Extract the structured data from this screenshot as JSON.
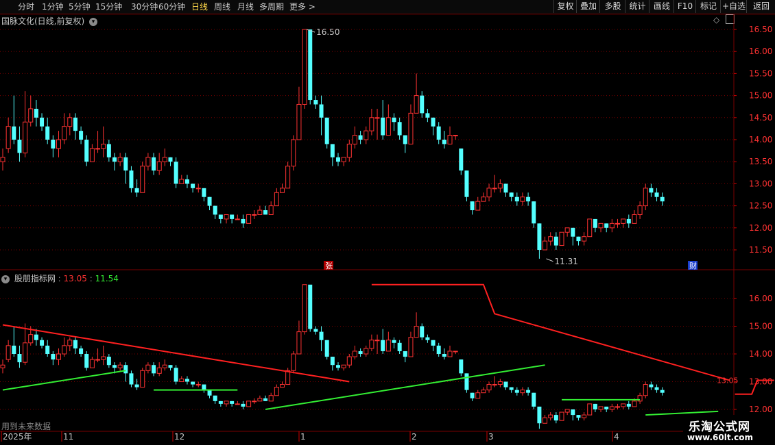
{
  "toolbar": {
    "periods": [
      "分时",
      "1分钟",
      "5分钟",
      "15分钟",
      "30分钟",
      "60分钟",
      "日线",
      "周线",
      "月线",
      "多周期",
      "更多 >"
    ],
    "active_period": "日线",
    "right_buttons": [
      "复权",
      "叠加",
      "多股",
      "统计",
      "画线",
      "F10",
      "标记",
      "+自选",
      "返回"
    ]
  },
  "main_chart": {
    "title": "国脉文化(日线,前复权)",
    "price_ticks": [
      "16.50",
      "16.00",
      "15.50",
      "15.00",
      "14.50",
      "14.00",
      "13.50",
      "13.00",
      "12.50",
      "12.00",
      "11.50"
    ],
    "high_label": "16.50",
    "low_label": "11.31",
    "badge_zhang": "张",
    "badge_cai": "财"
  },
  "indicator": {
    "name": "股朋指标网",
    "value_red": "13.05",
    "value_green": "11.54",
    "ticks": [
      "16.00",
      "15.00",
      "14.00",
      "13.00",
      "12.00"
    ],
    "current_label": "13.05",
    "footer_note": "用到未来数据"
  },
  "date_axis": [
    "2025年",
    "11",
    "12",
    "1",
    "2",
    "3",
    "4"
  ],
  "watermark": {
    "line1": "乐淘公式网",
    "line2": "www.60lt.com"
  },
  "colors": {
    "up": "#ff3232",
    "down": "#54ffff",
    "upper_line": "#ff2020",
    "lower_line": "#33ee33",
    "grid": "#7a0000"
  },
  "chart_data": {
    "type": "candlestick",
    "y_min": 11.31,
    "y_max": 16.5,
    "candles": [
      [
        13.5,
        13.6,
        13.3,
        13.8
      ],
      [
        13.8,
        14.3,
        13.7,
        14.5
      ],
      [
        14.3,
        14.0,
        13.9,
        15.0
      ],
      [
        14.0,
        13.7,
        13.5,
        14.3
      ],
      [
        13.7,
        14.4,
        13.6,
        15.1
      ],
      [
        14.4,
        14.7,
        14.3,
        15.0
      ],
      [
        14.7,
        14.5,
        14.3,
        14.9
      ],
      [
        14.5,
        14.3,
        14.2,
        14.6
      ],
      [
        14.3,
        14.0,
        13.9,
        14.5
      ],
      [
        14.0,
        13.8,
        13.6,
        14.1
      ],
      [
        13.8,
        14.0,
        13.6,
        14.2
      ],
      [
        14.0,
        14.3,
        13.9,
        14.6
      ],
      [
        14.3,
        14.5,
        14.1,
        14.6
      ],
      [
        14.5,
        14.2,
        14.0,
        14.6
      ],
      [
        14.2,
        14.0,
        13.9,
        14.3
      ],
      [
        14.0,
        13.5,
        13.4,
        14.1
      ],
      [
        13.5,
        13.8,
        13.5,
        13.9
      ],
      [
        13.8,
        13.8,
        13.7,
        14.2
      ],
      [
        13.8,
        13.9,
        13.6,
        14.3
      ],
      [
        13.9,
        13.6,
        13.5,
        14.0
      ],
      [
        13.6,
        13.5,
        13.3,
        13.7
      ],
      [
        13.5,
        13.6,
        13.4,
        13.7
      ],
      [
        13.6,
        13.3,
        13.0,
        13.7
      ],
      [
        13.3,
        12.9,
        12.8,
        13.4
      ],
      [
        12.9,
        12.8,
        12.7,
        13.1
      ],
      [
        12.8,
        13.4,
        12.8,
        13.5
      ],
      [
        13.4,
        13.6,
        13.3,
        13.7
      ],
      [
        13.6,
        13.3,
        13.2,
        13.7
      ],
      [
        13.3,
        13.5,
        13.2,
        13.7
      ],
      [
        13.5,
        13.6,
        13.4,
        13.8
      ],
      [
        13.6,
        13.5,
        13.4,
        13.6
      ],
      [
        13.5,
        13.0,
        12.9,
        13.6
      ],
      [
        13.0,
        13.1,
        13.0,
        13.2
      ],
      [
        13.1,
        13.0,
        12.9,
        13.2
      ],
      [
        13.0,
        12.9,
        12.8,
        13.0
      ],
      [
        12.9,
        12.9,
        12.8,
        13.0
      ],
      [
        12.9,
        12.7,
        12.6,
        12.9
      ],
      [
        12.7,
        12.5,
        12.4,
        12.7
      ],
      [
        12.5,
        12.3,
        12.2,
        12.5
      ],
      [
        12.3,
        12.2,
        12.1,
        12.3
      ],
      [
        12.2,
        12.3,
        12.1,
        12.3
      ],
      [
        12.3,
        12.2,
        12.1,
        12.3
      ],
      [
        12.2,
        12.2,
        12.2,
        12.3
      ],
      [
        12.2,
        12.1,
        12.0,
        12.3
      ],
      [
        12.1,
        12.3,
        12.1,
        12.3
      ],
      [
        12.3,
        12.3,
        12.2,
        12.4
      ],
      [
        12.3,
        12.4,
        12.3,
        12.5
      ],
      [
        12.4,
        12.3,
        12.3,
        12.5
      ],
      [
        12.3,
        12.5,
        12.3,
        12.6
      ],
      [
        12.5,
        12.8,
        12.5,
        12.9
      ],
      [
        12.8,
        12.9,
        12.8,
        13.0
      ],
      [
        12.9,
        13.4,
        12.9,
        13.5
      ],
      [
        13.4,
        14.0,
        13.3,
        14.1
      ],
      [
        14.0,
        14.8,
        14.0,
        15.2
      ],
      [
        14.8,
        16.5,
        14.7,
        16.5
      ],
      [
        16.5,
        14.9,
        14.8,
        16.0
      ],
      [
        14.9,
        14.8,
        14.7,
        15.0
      ],
      [
        14.8,
        14.5,
        14.1,
        15.0
      ],
      [
        14.5,
        13.9,
        13.8,
        14.5
      ],
      [
        13.9,
        13.6,
        13.4,
        13.9
      ],
      [
        13.6,
        13.5,
        13.4,
        13.7
      ],
      [
        13.5,
        13.6,
        13.4,
        13.6
      ],
      [
        13.6,
        13.9,
        13.5,
        14.0
      ],
      [
        13.9,
        14.1,
        13.8,
        14.3
      ],
      [
        14.1,
        14.0,
        13.9,
        14.2
      ],
      [
        14.0,
        14.2,
        13.9,
        14.3
      ],
      [
        14.2,
        14.5,
        14.1,
        14.7
      ],
      [
        14.5,
        14.5,
        14.0,
        14.7
      ],
      [
        14.5,
        14.1,
        14.0,
        14.9
      ],
      [
        14.1,
        14.5,
        14.1,
        14.8
      ],
      [
        14.5,
        14.4,
        14.2,
        14.6
      ],
      [
        14.4,
        14.1,
        14.0,
        14.5
      ],
      [
        14.1,
        13.9,
        13.7,
        14.1
      ],
      [
        13.9,
        14.6,
        13.9,
        14.8
      ],
      [
        14.6,
        15.0,
        14.6,
        15.5
      ],
      [
        15.0,
        14.6,
        14.5,
        15.1
      ],
      [
        14.6,
        14.5,
        14.4,
        14.7
      ],
      [
        14.5,
        14.3,
        14.1,
        14.5
      ],
      [
        14.3,
        14.0,
        13.9,
        14.4
      ],
      [
        14.0,
        13.9,
        13.8,
        14.2
      ],
      [
        13.9,
        14.1,
        13.9,
        14.3
      ],
      [
        14.1,
        14.1,
        14.0,
        14.1
      ],
      [
        13.8,
        13.3,
        13.2,
        13.8
      ],
      [
        13.3,
        12.7,
        12.6,
        13.3
      ],
      [
        12.6,
        12.4,
        12.3,
        12.6
      ],
      [
        12.4,
        12.6,
        12.4,
        12.7
      ],
      [
        12.6,
        12.7,
        12.6,
        12.8
      ],
      [
        12.7,
        12.9,
        12.6,
        13.0
      ],
      [
        12.9,
        12.9,
        12.8,
        13.2
      ],
      [
        12.9,
        13.0,
        12.8,
        13.1
      ],
      [
        13.0,
        12.8,
        12.7,
        13.0
      ],
      [
        12.8,
        12.7,
        12.6,
        12.8
      ],
      [
        12.7,
        12.6,
        12.5,
        12.8
      ],
      [
        12.6,
        12.7,
        12.5,
        12.8
      ],
      [
        12.7,
        12.6,
        12.5,
        12.8
      ],
      [
        12.6,
        12.1,
        12.0,
        12.6
      ],
      [
        12.1,
        11.5,
        11.3,
        12.1
      ],
      [
        11.5,
        11.7,
        11.5,
        11.8
      ],
      [
        11.7,
        11.8,
        11.6,
        11.9
      ],
      [
        11.8,
        11.6,
        11.5,
        11.9
      ],
      [
        11.6,
        11.9,
        11.6,
        11.9
      ],
      [
        11.9,
        12.0,
        11.8,
        12.0
      ],
      [
        12.0,
        11.8,
        11.6,
        12.0
      ],
      [
        11.8,
        11.7,
        11.6,
        11.8
      ],
      [
        11.7,
        11.8,
        11.6,
        11.9
      ],
      [
        11.8,
        12.2,
        11.8,
        12.2
      ],
      [
        12.2,
        12.0,
        11.9,
        12.2
      ],
      [
        12.0,
        12.1,
        11.9,
        12.1
      ],
      [
        12.1,
        12.0,
        11.9,
        12.1
      ],
      [
        12.0,
        12.1,
        11.9,
        12.2
      ],
      [
        12.1,
        12.1,
        12.0,
        12.2
      ],
      [
        12.1,
        12.2,
        12.0,
        12.2
      ],
      [
        12.2,
        12.1,
        12.0,
        12.3
      ],
      [
        12.1,
        12.3,
        12.1,
        12.4
      ],
      [
        12.3,
        12.5,
        12.2,
        12.6
      ],
      [
        12.5,
        12.9,
        12.4,
        13.0
      ],
      [
        12.9,
        12.8,
        12.7,
        13.0
      ],
      [
        12.8,
        12.7,
        12.6,
        12.9
      ],
      [
        12.7,
        12.6,
        12.5,
        12.8
      ]
    ],
    "indicator_upper_segments": [
      [
        [
          0,
          15.05
        ],
        [
          62,
          13.0
        ]
      ],
      [
        [
          66,
          16.5
        ],
        [
          86,
          16.5
        ],
        [
          88,
          15.45
        ],
        [
          130,
          13.05
        ]
      ],
      [
        [
          131,
          12.55
        ],
        [
          134,
          12.55
        ],
        [
          135,
          13.05
        ],
        [
          138,
          13.05
        ]
      ]
    ],
    "indicator_lower_segments": [
      [
        [
          0,
          12.7
        ],
        [
          22,
          13.4
        ]
      ],
      [
        [
          27,
          12.7
        ],
        [
          42,
          12.7
        ]
      ],
      [
        [
          47,
          12.0
        ],
        [
          97,
          13.6
        ]
      ],
      [
        [
          100,
          12.35
        ],
        [
          114,
          12.35
        ]
      ],
      [
        [
          115,
          11.8
        ],
        [
          128,
          11.93
        ]
      ]
    ]
  }
}
